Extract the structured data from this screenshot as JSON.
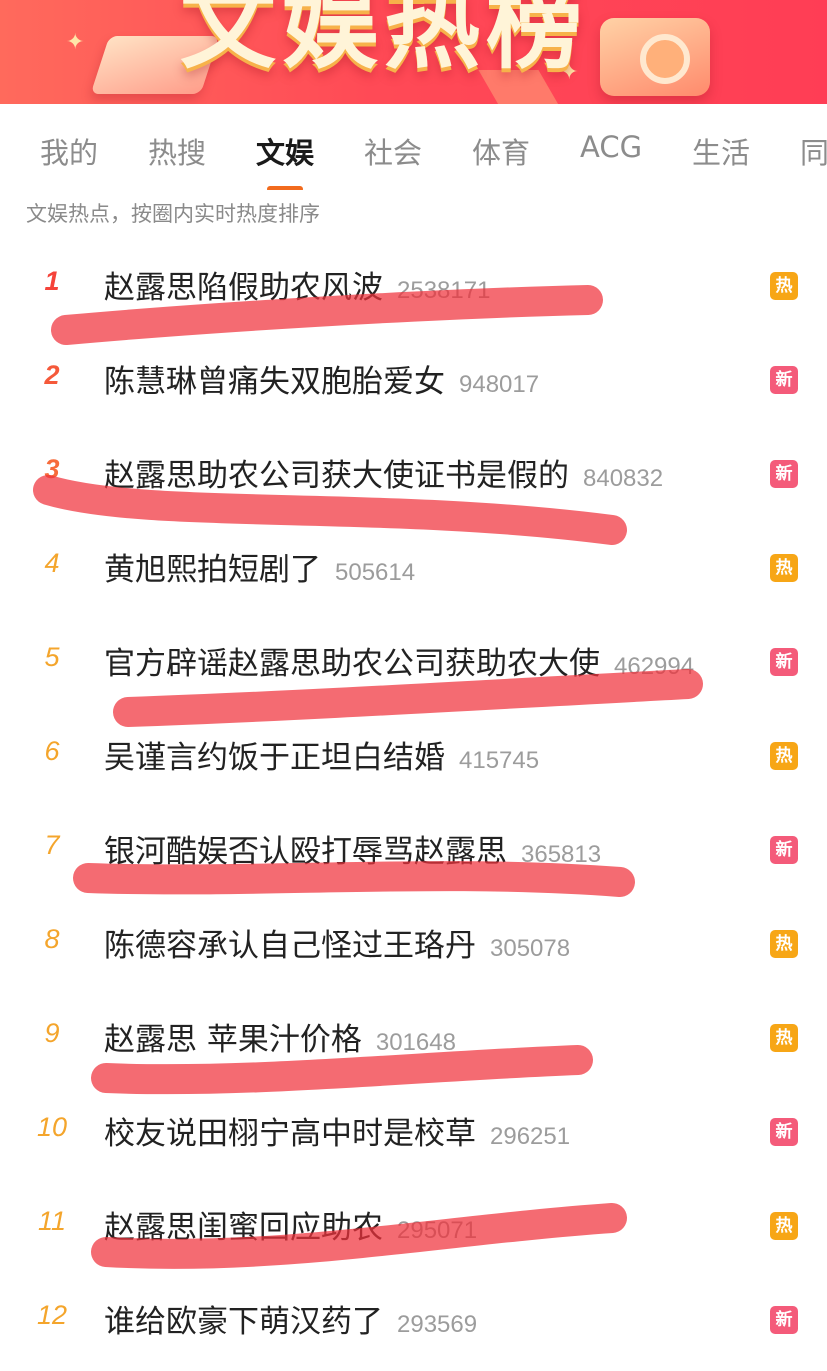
{
  "banner": {
    "title": "文娱热榜"
  },
  "tabs": [
    {
      "label": "我的",
      "active": false
    },
    {
      "label": "热搜",
      "active": false
    },
    {
      "label": "文娱",
      "active": true
    },
    {
      "label": "社会",
      "active": false
    },
    {
      "label": "体育",
      "active": false
    },
    {
      "label": "ACG",
      "active": false
    },
    {
      "label": "生活",
      "active": false
    },
    {
      "label": "同",
      "active": false
    }
  ],
  "subtitle": "文娱热点，按圈内实时热度排序",
  "items": [
    {
      "rank": "1",
      "title": "赵露思陷假助农风波",
      "count": "2538171",
      "badge": "热",
      "badge_type": "hot"
    },
    {
      "rank": "2",
      "title": "陈慧琳曾痛失双胞胎爱女",
      "count": "948017",
      "badge": "新",
      "badge_type": "new"
    },
    {
      "rank": "3",
      "title": "赵露思助农公司获大使证书是假的",
      "count": "840832",
      "badge": "新",
      "badge_type": "new"
    },
    {
      "rank": "4",
      "title": "黄旭熙拍短剧了",
      "count": "505614",
      "badge": "热",
      "badge_type": "hot"
    },
    {
      "rank": "5",
      "title": "官方辟谣赵露思助农公司获助农大使",
      "count": "462994",
      "badge": "新",
      "badge_type": "new"
    },
    {
      "rank": "6",
      "title": "吴谨言约饭于正坦白结婚",
      "count": "415745",
      "badge": "热",
      "badge_type": "hot"
    },
    {
      "rank": "7",
      "title": "银河酷娱否认殴打辱骂赵露思",
      "count": "365813",
      "badge": "新",
      "badge_type": "new"
    },
    {
      "rank": "8",
      "title": "陈德容承认自己怪过王珞丹",
      "count": "305078",
      "badge": "热",
      "badge_type": "hot"
    },
    {
      "rank": "9",
      "title": "赵露思 苹果汁价格",
      "count": "301648",
      "badge": "热",
      "badge_type": "hot"
    },
    {
      "rank": "10",
      "title": "校友说田栩宁高中时是校草",
      "count": "296251",
      "badge": "新",
      "badge_type": "new"
    },
    {
      "rank": "11",
      "title": "赵露思闺蜜回应助农",
      "count": "295071",
      "badge": "热",
      "badge_type": "hot"
    },
    {
      "rank": "12",
      "title": "谁给欧豪下萌汉药了",
      "count": "293569",
      "badge": "新",
      "badge_type": "new"
    }
  ],
  "colors": {
    "accent": "#f26b1d",
    "hot_badge": "#f7a616",
    "new_badge": "#f45b7a",
    "highlight_stroke": "#f0323c"
  },
  "annotations": {
    "highlighted_ranks": [
      "1",
      "3",
      "5",
      "7",
      "9",
      "11"
    ]
  }
}
